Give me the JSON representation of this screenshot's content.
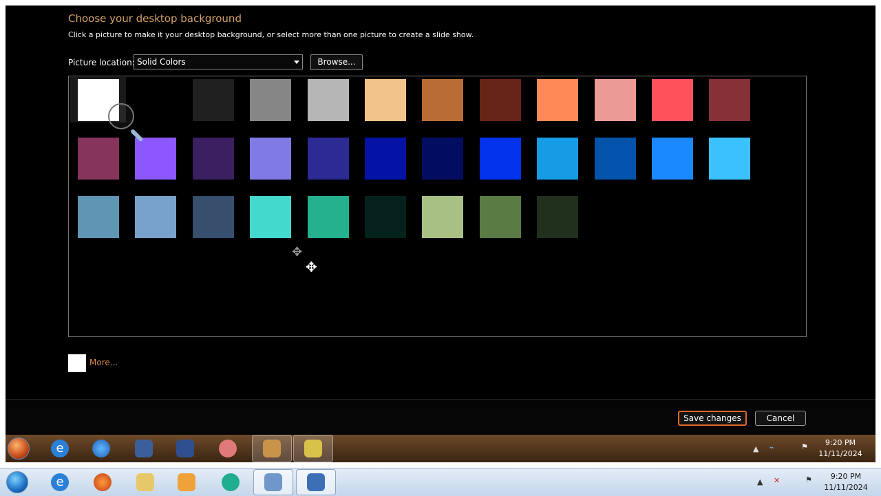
{
  "header": {
    "title": "Choose your desktop background",
    "subtitle": "Click a picture to make it your desktop background, or select more than one picture to create a slide show."
  },
  "location": {
    "label": "Picture location:",
    "value": "Solid Colors",
    "browse_label": "Browse..."
  },
  "swatches": [
    [
      "#ffffff",
      "#000000",
      "#202020",
      "#868686",
      "#b6b6b6",
      "#f2c48c",
      "#b96d34",
      "#672518",
      "#ff8a58",
      "#ec9a96",
      "#fd525b",
      "#863137"
    ],
    [
      "#87345d",
      "#8b58ff",
      "#3b1f60",
      "#807ae4",
      "#2c2b94",
      "#0412a6",
      "#020d62",
      "#0333ec",
      "#159ce4",
      "#0353aa",
      "#1a88ff",
      "#3cc1ff"
    ],
    [
      "#6096b3",
      "#78a1cb",
      "#374e6c",
      "#43d9cc",
      "#25b08e",
      "#04221b",
      "#a9c085",
      "#5a7b43",
      "#21301c"
    ]
  ],
  "more": {
    "label": "More...",
    "color": "#ffffff"
  },
  "footer": {
    "save_label": "Save changes",
    "cancel_label": "Cancel",
    "accent": "#e06a2a"
  },
  "taskbar": {
    "time": "9:20 PM",
    "date": "11/11/2024",
    "icons": [
      "start-orb-icon",
      "internet-explorer-icon",
      "browser-icon",
      "file-explorer-icon",
      "media-player-icon",
      "chat-icon",
      "control-panel-icon",
      "display-settings-icon"
    ]
  }
}
